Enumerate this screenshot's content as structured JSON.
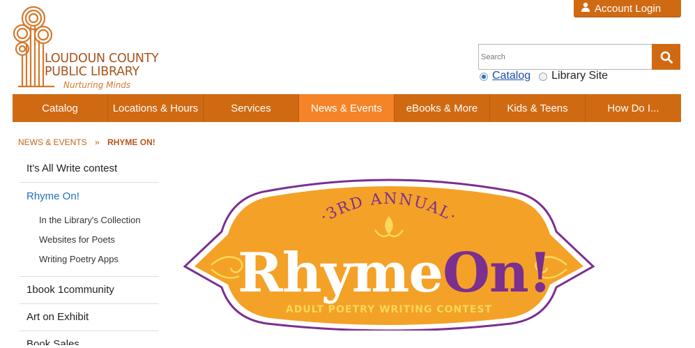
{
  "logo": {
    "line1": "LOUDOUN COUNTY",
    "line2": "PUBLIC LIBRARY",
    "tagline": "Nurturing Minds"
  },
  "account": {
    "label": "Account Login",
    "icon": "user-icon"
  },
  "search": {
    "placeholder": "Search",
    "value": "",
    "button_icon": "search-icon",
    "options": [
      {
        "label": "Catalog",
        "selected": true
      },
      {
        "label": "Library Site",
        "selected": false
      }
    ]
  },
  "nav": {
    "items": [
      {
        "label": "Catalog"
      },
      {
        "label": "Locations & Hours"
      },
      {
        "label": "Services"
      },
      {
        "label": "News & Events",
        "active": true
      },
      {
        "label": "eBooks & More"
      },
      {
        "label": "Kids & Teens"
      },
      {
        "label": "How Do I..."
      }
    ]
  },
  "breadcrumb": {
    "parent": "News & Events",
    "separator": "»",
    "current": "Rhyme On!"
  },
  "sidebar": {
    "items": [
      {
        "label": "It's All Write contest"
      },
      {
        "label": "Rhyme On!",
        "active": true
      },
      {
        "label": "1book 1community"
      },
      {
        "label": "Art on Exhibit"
      },
      {
        "label": "Book Sales"
      }
    ],
    "sub_items": [
      {
        "label": "In the Library's Collection"
      },
      {
        "label": "Websites for Poets"
      },
      {
        "label": "Writing Poetry Apps"
      }
    ]
  },
  "banner": {
    "arc_text": "·3RD ANNUAL·",
    "title_part1": "Rhyme",
    "title_part2": "On!",
    "subtitle": "ADULT POETRY WRITING CONTEST"
  },
  "colors": {
    "brand_orange": "#d06a12",
    "nav_active": "#f58428",
    "link_blue": "#1f6fb8",
    "banner_orange": "#f4a127",
    "banner_purple": "#7b2f8f"
  }
}
